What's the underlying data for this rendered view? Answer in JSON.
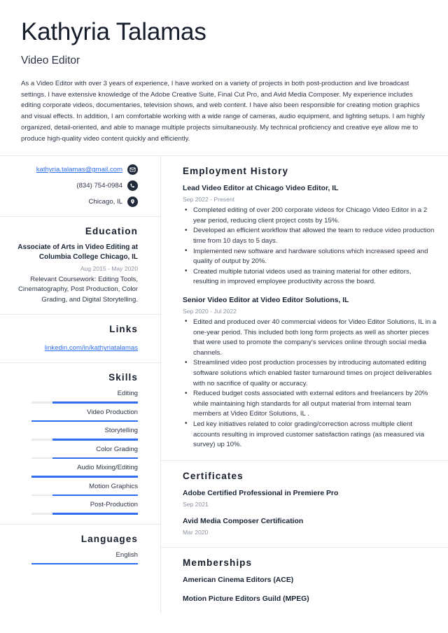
{
  "header": {
    "full_name": "Kathyria Talamas",
    "job_title": "Video Editor",
    "summary": "As a Video Editor with over 3 years of experience, I have worked on a variety of projects in both post-production and live broadcast settings. I have extensive knowledge of the Adobe Creative Suite, Final Cut Pro, and Avid Media Composer. My experience includes editing corporate videos, documentaries, television shows, and web content. I have also been responsible for creating motion graphics and visual effects. In addition, I am comfortable working with a wide range of cameras, audio equipment, and lighting setups. I am highly organized, detail-oriented, and able to manage multiple projects simultaneously. My technical proficiency and creative eye allow me to produce high-quality video content quickly and efficiently."
  },
  "contact": {
    "email": "kathyria.talamas@gmail.com",
    "email_icon": "envelope-icon",
    "phone": "(834) 754-0984",
    "phone_icon": "phone-icon",
    "location": "Chicago, IL",
    "location_icon": "map-pin-icon"
  },
  "education": {
    "heading": "Education",
    "degree": "Associate of Arts in Video Editing at Columbia College Chicago, IL",
    "dates": "Aug 2015 - May 2020",
    "description": "Relevant Coursework: Editing Tools, Cinematography, Post Production, Color Grading, and Digital Storytelling."
  },
  "links": {
    "heading": "Links",
    "items": [
      {
        "label": "linkedin.com/in/kathyriatalamas"
      }
    ]
  },
  "skills": {
    "heading": "Skills",
    "items": [
      {
        "label": "Editing",
        "level": 80
      },
      {
        "label": "Video Production",
        "level": 100
      },
      {
        "label": "Storytelling",
        "level": 80
      },
      {
        "label": "Color Grading",
        "level": 80
      },
      {
        "label": "Audio Mixing/Editing",
        "level": 100
      },
      {
        "label": "Motion Graphics",
        "level": 80
      },
      {
        "label": "Post-Production",
        "level": 80
      }
    ]
  },
  "languages": {
    "heading": "Languages",
    "items": [
      {
        "label": "English",
        "level": 100
      }
    ]
  },
  "employment": {
    "heading": "Employment History",
    "jobs": [
      {
        "role": "Lead Video Editor at Chicago Video Editor, IL",
        "dates": "Sep 2022 - Present",
        "bullets": [
          "Completed editing of over 200 corporate videos for Chicago Video Editor in a 2 year period, reducing client project costs by 15%.",
          "Developed an efficient workflow that allowed the team to reduce video production time from 10 days to 5 days.",
          "Implemented new software and hardware solutions which increased speed and quality of output by 20%.",
          "Created multiple tutorial videos used as training material for other editors, resulting in improved employee productivity across the board."
        ]
      },
      {
        "role": "Senior Video Editor at Video Editor Solutions, IL",
        "dates": "Sep 2020 - Jul 2022",
        "bullets": [
          "Edited and produced over 40 commercial videos for Video Editor Solutions, IL in a one-year period. This included both long form projects as well as shorter pieces that were used to promote the company's services online through social media channels.",
          "Streamlined video post production processes by introducing automated editing software solutions which enabled faster turnaround times on project deliverables with no sacrifice of quality or accuracy.",
          "Reduced budget costs associated with external editors and freelancers by 20% while maintaining high standards for all output material from internal team members at Video Editor Solutions, IL .",
          "Led key initiatives related to color grading/correction across multiple client accounts resulting in improved customer satisfaction ratings (as measured via survey) up 10%."
        ]
      }
    ]
  },
  "certificates": {
    "heading": "Certificates",
    "items": [
      {
        "name": "Adobe Certified Professional in Premiere Pro",
        "date": "Sep 2021"
      },
      {
        "name": "Avid Media Composer Certification",
        "date": "Mar 2020"
      }
    ]
  },
  "memberships": {
    "heading": "Memberships",
    "items": [
      {
        "name": "American Cinema Editors (ACE)"
      },
      {
        "name": "Motion Picture Editors Guild (MPEG)"
      }
    ]
  },
  "colors": {
    "accent_blue": "#2f6fed",
    "track_gray": "#e9eaec",
    "heading_dark": "#161d2b",
    "muted_gray": "#8b93a1",
    "divider": "#e6e8ec"
  }
}
